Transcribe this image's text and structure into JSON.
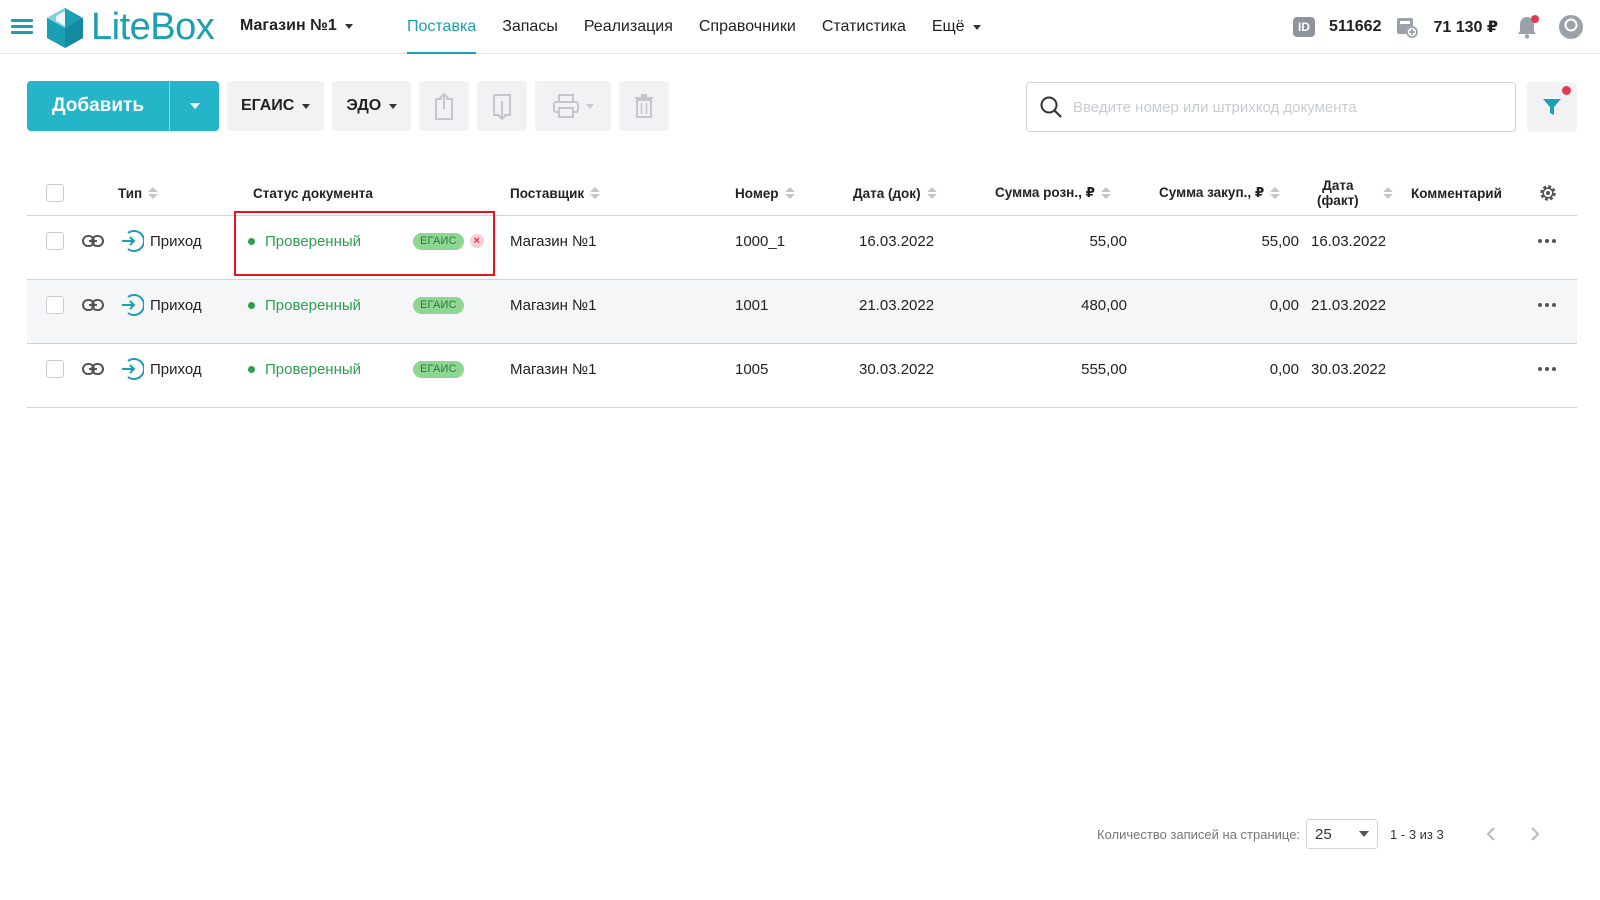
{
  "app": {
    "name": "LiteBox",
    "accent": "#1a9fb3",
    "status_color": "#2e9e4e",
    "highlight_color": "#e8131f"
  },
  "header": {
    "store": "Магазин №1",
    "nav": [
      {
        "label": "Поставка",
        "active": true
      },
      {
        "label": "Запасы"
      },
      {
        "label": "Реализация"
      },
      {
        "label": "Справочники"
      },
      {
        "label": "Статистика"
      },
      {
        "label": "Ещё"
      }
    ],
    "id_label": "ID",
    "id_value": "511662",
    "balance": "71 130 ₽"
  },
  "toolbar": {
    "add": "Добавить",
    "egais": "ЕГАИС",
    "edo": "ЭДО",
    "icons": [
      "export-icon",
      "import-icon",
      "print-icon",
      "delete-icon"
    ]
  },
  "search": {
    "placeholder": "Введите номер или штрихкод документа"
  },
  "table": {
    "columns": {
      "type": "Тип",
      "status": "Статус документа",
      "supplier": "Поставщик",
      "number": "Номер",
      "doc_date": "Дата (док)",
      "retail_sum": "Сумма розн., ₽",
      "purchase_sum": "Сумма закуп., ₽",
      "fact_date_1": "Дата",
      "fact_date_2": "(факт)",
      "comment": "Комментарий"
    },
    "rows": [
      {
        "type": "Приход",
        "status": "Проверенный",
        "badge": "ЕГАИС",
        "supplier": "Магазин №1",
        "number": "1000_1",
        "doc_date": "16.03.2022",
        "retail_sum": "55,00",
        "purchase_sum": "55,00",
        "fact_date": "16.03.2022",
        "comment": ""
      },
      {
        "type": "Приход",
        "status": "Проверенный",
        "badge": "ЕГАИС",
        "supplier": "Магазин №1",
        "number": "1001",
        "doc_date": "21.03.2022",
        "retail_sum": "480,00",
        "purchase_sum": "0,00",
        "fact_date": "21.03.2022",
        "comment": ""
      },
      {
        "type": "Приход",
        "status": "Проверенный",
        "badge": "ЕГАИС",
        "supplier": "Магазин №1",
        "number": "1005",
        "doc_date": "30.03.2022",
        "retail_sum": "555,00",
        "purchase_sum": "0,00",
        "fact_date": "30.03.2022",
        "comment": ""
      }
    ]
  },
  "pagination": {
    "per_page_label": "Количество записей на странице:",
    "per_page": "25",
    "range": "1 - 3 из 3"
  }
}
